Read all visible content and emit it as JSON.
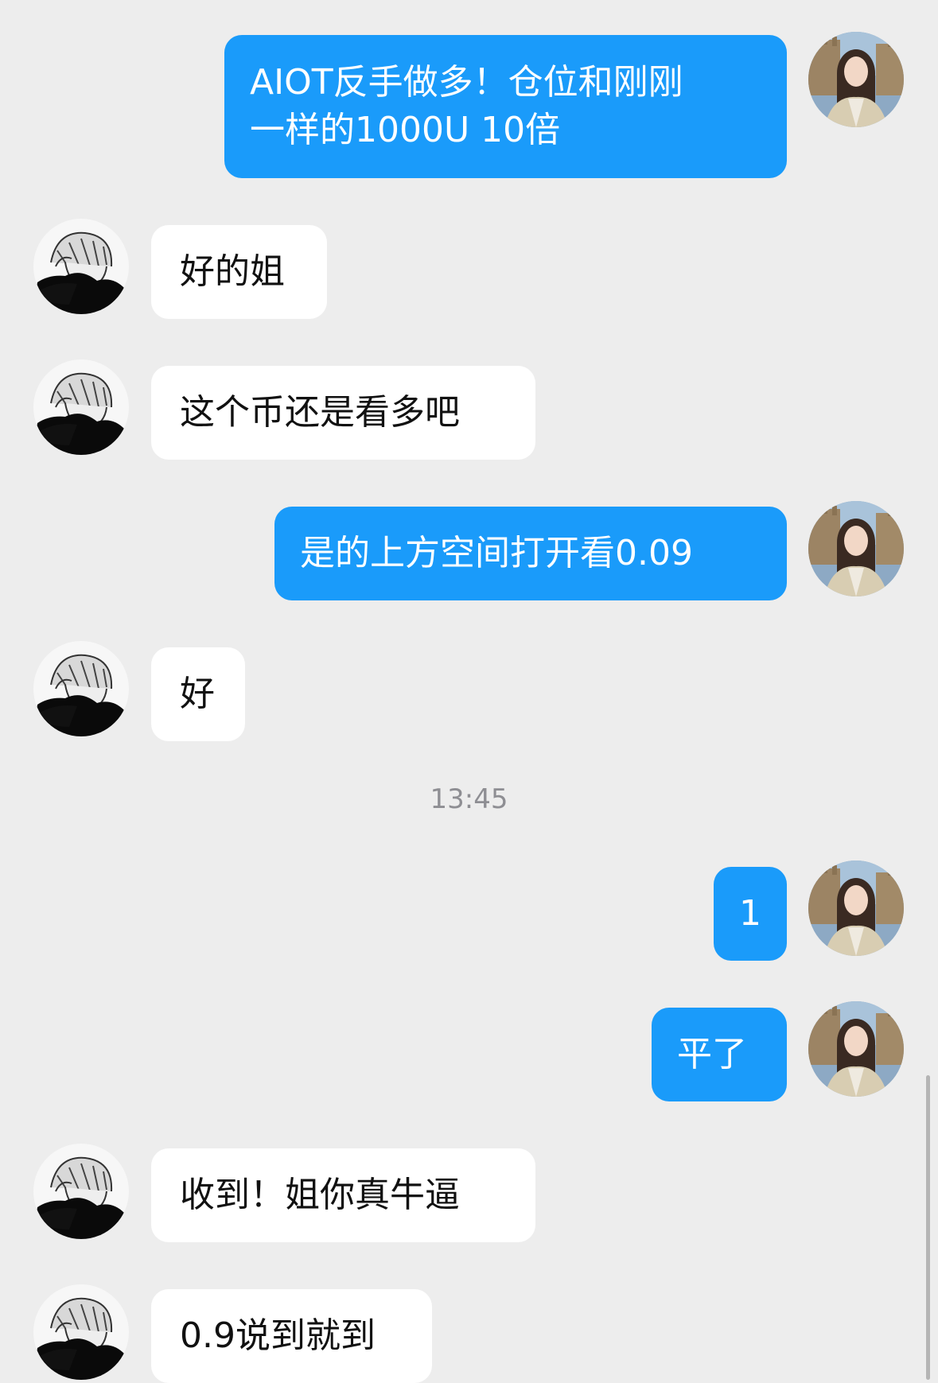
{
  "colors": {
    "background": "#EDEDED",
    "outgoing_bubble": "#1A9BFA",
    "incoming_bubble": "#FFFFFF",
    "timestamp_text": "#8E8E93"
  },
  "messages": [
    {
      "sender": "self",
      "text": "AIOT反手做多！仓位和刚刚\n一样的1000U 10倍",
      "avatar": "woman-photo-avatar"
    },
    {
      "sender": "other",
      "text": "好的姐",
      "avatar": "anime-avatar"
    },
    {
      "sender": "other",
      "text": "这个币还是看多吧",
      "avatar": "anime-avatar"
    },
    {
      "sender": "self",
      "text": "是的上方空间打开看0.09",
      "avatar": "woman-photo-avatar"
    },
    {
      "sender": "other",
      "text": "好",
      "avatar": "anime-avatar"
    },
    {
      "timestamp": "13:45"
    },
    {
      "sender": "self",
      "text": "1",
      "avatar": "woman-photo-avatar"
    },
    {
      "sender": "self",
      "text": "平了",
      "avatar": "woman-photo-avatar"
    },
    {
      "sender": "other",
      "text": "收到！姐你真牛逼",
      "avatar": "anime-avatar"
    },
    {
      "sender": "other",
      "text": "0.9说到就到",
      "avatar": "anime-avatar"
    }
  ]
}
